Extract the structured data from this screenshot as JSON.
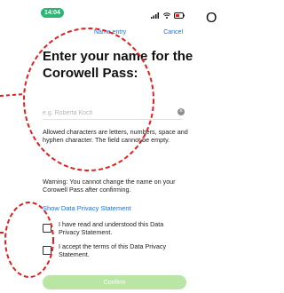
{
  "status_bar": {
    "time": "14:04"
  },
  "nav": {
    "title": "Name entry",
    "cancel_label": "Cancel"
  },
  "title": "Enter your name for the Corowell Pass:",
  "name_input": {
    "placeholder": "e.g. Roberta Koch",
    "value": ""
  },
  "hint_text": "Allowed characters are letters, numbers, space and hyphen character. The field cannot be empty.",
  "warning_text": "Warning: You cannot change the name on your Corowell Pass after confirming.",
  "privacy_link_label": "Show Data Privacy Statement",
  "checkboxes": [
    {
      "label": "I have read and understood this Data Privacy Statement.",
      "checked": false
    },
    {
      "label": "I accept the terms of this Data Privacy Statement.",
      "checked": false
    }
  ],
  "confirm_label": "Confirm",
  "side_letter": "O",
  "colors": {
    "accent": "#1a73e8",
    "time_pill": "#2bb673",
    "confirm_disabled": "#b9e6a4",
    "annotation": "#e02020"
  }
}
